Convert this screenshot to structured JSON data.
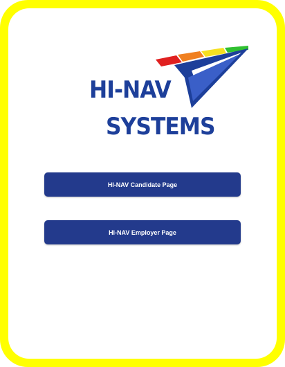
{
  "brand": {
    "line1": "HI-NAV",
    "line2": "SYSTEMS",
    "primary_color": "#1d3f9a",
    "stripe_colors": [
      "#e02020",
      "#f08020",
      "#f5e020",
      "#30c030"
    ],
    "frame_color": "#ffff00"
  },
  "buttons": {
    "candidate_label": "HI-NAV Candidate Page",
    "employer_label": "HI-NAV Employer Page",
    "color": "#233a8c"
  }
}
